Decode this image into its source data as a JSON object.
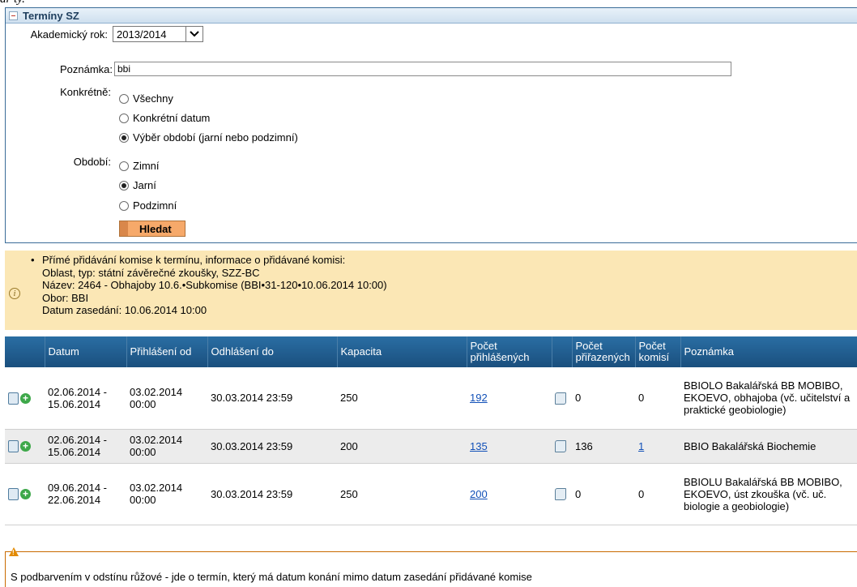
{
  "page_fragment": "ar ty.",
  "panel": {
    "title": "Termíny SZ",
    "akademicky_label": "Akademický rok:",
    "akademicky_value": "2013/2014",
    "poznamka_label": "Poznámka:",
    "poznamka_value": "bbi",
    "konkretne_label": "Konkrétně:",
    "konkretne_options": [
      "Všechny",
      "Konkrétní datum",
      "Výběr období (jarní nebo podzimní)"
    ],
    "konkretne_selected": 2,
    "obdobi_label": "Období:",
    "obdobi_options": [
      "Zimní",
      "Jarní",
      "Podzimní"
    ],
    "obdobi_selected": 1,
    "search_button": "Hledat"
  },
  "info": {
    "line1": "Přímé přidávání komise k termínu, informace o přidávané komisi:",
    "line2": "Oblast, typ: státní závěrečné zkoušky, SZZ-BC",
    "line3": "Název: 2464 - Obhajoby 10.6.•Subkomise (BBI•31-120•10.06.2014 10:00)",
    "line4": "Obor: BBI",
    "line5": "Datum zasedání: 10.06.2014 10:00"
  },
  "table": {
    "headers": {
      "datum": "Datum",
      "prihlaseni": "Přihlášení od",
      "odhlaseni": "Odhlášení do",
      "kapacita": "Kapacita",
      "pocet_prihlasenych": "Počet přihlášených",
      "pocet_prirazenych": "Počet přiřazených",
      "pocet_komisi": "Počet komisí",
      "poznamka": "Poznámka"
    },
    "rows": [
      {
        "datum": "02.06.2014 - 15.06.2014",
        "prihlaseni": "03.02.2014 00:00",
        "odhlaseni": "30.03.2014 23:59",
        "kapacita": "250",
        "prihlasenych": "192",
        "prirazenych": "0",
        "komisi": "0",
        "komisi_link": false,
        "poznamka": "BBIOLO Bakalářská BB MOBIBO, EKOEVO, obhajoba (vč. učitelství a praktické geobiologie)"
      },
      {
        "datum": "02.06.2014 - 15.06.2014",
        "prihlaseni": "03.02.2014 00:00",
        "odhlaseni": "30.03.2014 23:59",
        "kapacita": "200",
        "prihlasenych": "135",
        "prirazenych": "136",
        "komisi": "1",
        "komisi_link": true,
        "poznamka": "BBIO Bakalářská Biochemie"
      },
      {
        "datum": "09.06.2014 - 22.06.2014",
        "prihlaseni": "03.02.2014 00:00",
        "odhlaseni": "30.03.2014 23:59",
        "kapacita": "250",
        "prihlasenych": "200",
        "prirazenych": "0",
        "komisi": "0",
        "komisi_link": false,
        "poznamka": "BBIOLU Bakalářská BB MOBIBO, EKOEVO, úst zkouška (vč. uč. biologie a geobiologie)"
      }
    ]
  },
  "warning": {
    "text": "S podbarvením v odstínu růžové - jde o termín, který má datum konání mimo datum zasedání přidávané komise"
  },
  "colors": {
    "header_blue": "#1f5c8f",
    "info_bg": "#fbe7b5",
    "button_orange": "#f6a96a",
    "link": "#1150b8",
    "warning": "#e38a00"
  }
}
